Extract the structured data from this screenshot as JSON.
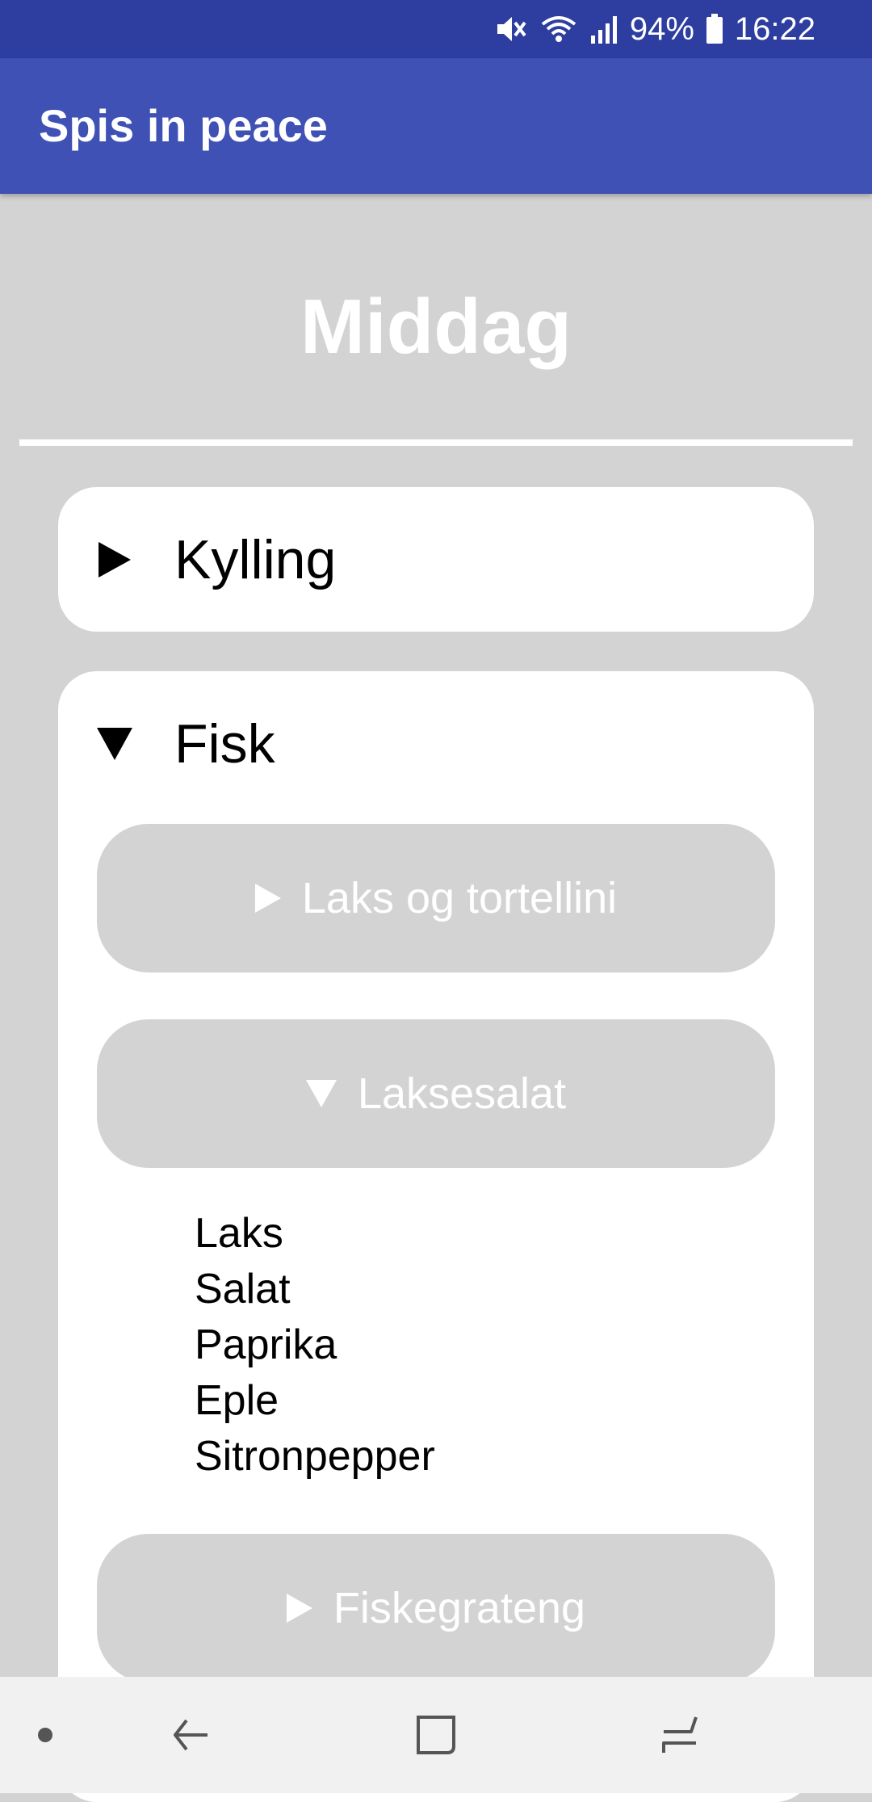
{
  "status_bar": {
    "battery": "94%",
    "time": "16:22",
    "icons": [
      "mute-icon",
      "wifi-icon",
      "signal-icon",
      "battery-icon"
    ]
  },
  "app_bar": {
    "title": "Spis in peace"
  },
  "page": {
    "title": "Middag"
  },
  "categories": [
    {
      "label": "Kylling",
      "expanded": false
    },
    {
      "label": "Fisk",
      "expanded": true,
      "dishes": [
        {
          "label": "Laks og tortellini",
          "expanded": false
        },
        {
          "label": "Laksesalat",
          "expanded": true,
          "ingredients": [
            "Laks",
            "Salat",
            "Paprika",
            "Eple",
            "Sitronpepper"
          ]
        },
        {
          "label": "Fiskegrateng",
          "expanded": false
        }
      ]
    }
  ],
  "nav_bar": {
    "icons": [
      "dot-icon",
      "back-icon",
      "home-icon",
      "recents-icon"
    ]
  },
  "colors": {
    "status_bar": "#2e3da0",
    "app_bar": "#3f51b5",
    "background": "#d3d3d3",
    "card": "#ffffff",
    "sub_button": "#d3d3d3",
    "nav_bar": "#f1f1f1"
  }
}
